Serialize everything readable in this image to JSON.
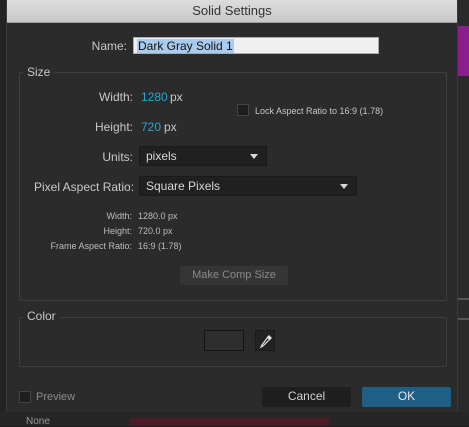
{
  "window": {
    "title": "Solid Settings"
  },
  "name": {
    "label": "Name:",
    "value": "Dark Gray Solid 1"
  },
  "size": {
    "group_title": "Size",
    "width_label": "Width:",
    "width_value": "1280",
    "width_unit": "px",
    "height_label": "Height:",
    "height_value": "720",
    "height_unit": "px",
    "lock_label": "Lock Aspect Ratio to 16:9 (1.78)",
    "lock_checked": false,
    "units_label": "Units:",
    "units_value": "pixels",
    "par_label": "Pixel Aspect Ratio:",
    "par_value": "Square Pixels",
    "info": {
      "width_label": "Width:",
      "width_value": "1280.0 px",
      "height_label": "Height:",
      "height_value": "720.0 px",
      "far_label": "Frame Aspect Ratio:",
      "far_value": "16:9 (1.78)"
    },
    "make_comp_size": "Make Comp Size"
  },
  "color": {
    "group_title": "Color",
    "swatch_hex": "#2e2e2e"
  },
  "footer": {
    "preview_label": "Preview",
    "preview_checked": false,
    "cancel_label": "Cancel",
    "ok_label": "OK"
  },
  "background": {
    "bottom_text": "None"
  },
  "icons": {
    "dropdown": "chevron-down-icon",
    "eyedropper": "eyedropper-icon"
  }
}
